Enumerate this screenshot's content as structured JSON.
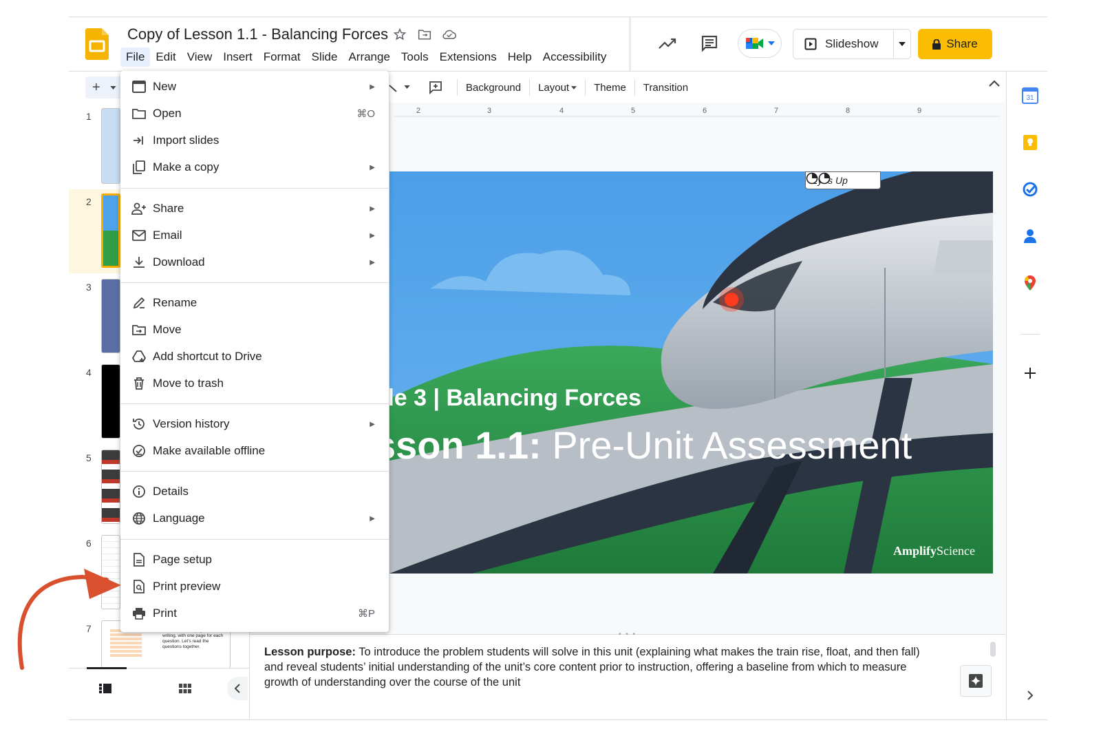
{
  "header": {
    "doc_title": "Copy of Lesson 1.1 - Balancing Forces",
    "menu": [
      "File",
      "Edit",
      "View",
      "Insert",
      "Format",
      "Slide",
      "Arrange",
      "Tools",
      "Extensions",
      "Help",
      "Accessibility"
    ],
    "slideshow_label": "Slideshow",
    "share_label": "Share"
  },
  "toolbar": {
    "items": [
      "Background",
      "Layout",
      "Theme",
      "Transition"
    ]
  },
  "filmstrip": {
    "slide_numbers": [
      "1",
      "2",
      "3",
      "4",
      "5",
      "6",
      "7"
    ],
    "slide7_text": "There are three pages for writing, with one page for each question. Let's read the questions together."
  },
  "ruler": [
    "2",
    "3",
    "4",
    "5",
    "6",
    "7",
    "8",
    "9"
  ],
  "slide": {
    "badge": "Eyes Up",
    "grade_line": "de 3 | Balancing Forces",
    "lesson_bold": "sson 1.1:",
    "lesson_rest": " Pre-Unit Assessment",
    "brand_bold": "Amplify",
    "brand_rest": "Science"
  },
  "notes": {
    "label": "Lesson purpose:",
    "text": " To introduce the problem students will solve in this unit (explaining what makes the train rise, float, and then fall) and reveal students’ initial understanding of the unit’s core content prior to instruction, offering a baseline from which to measure growth of understanding over the course of the unit"
  },
  "file_menu": {
    "new": "New",
    "open": "Open",
    "open_shortcut": "⌘O",
    "import_slides": "Import slides",
    "make_copy": "Make a copy",
    "share": "Share",
    "email": "Email",
    "download": "Download",
    "rename": "Rename",
    "move": "Move",
    "add_shortcut": "Add shortcut to Drive",
    "move_trash": "Move to trash",
    "version_history": "Version history",
    "offline": "Make available offline",
    "details": "Details",
    "language": "Language",
    "page_setup": "Page setup",
    "print_preview": "Print preview",
    "print": "Print",
    "print_shortcut": "⌘P"
  },
  "colors": {
    "accent_yellow": "#fbbc04",
    "selection_bg": "#e8f0fe",
    "annotation_arrow": "#d9502f"
  }
}
